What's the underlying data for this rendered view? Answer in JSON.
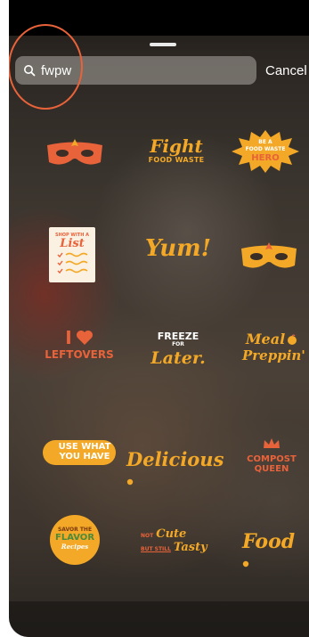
{
  "search": {
    "query": "fwpw",
    "cancel_label": "Cancel"
  },
  "colors": {
    "accent_orange": "#f3a927",
    "accent_red": "#e8623a"
  },
  "stickers": {
    "fight": {
      "line1": "Fight",
      "line2": "FOOD WASTE"
    },
    "hero": {
      "line1": "BE A",
      "line2": "FOOD WASTE",
      "line3": "HERO"
    },
    "list": {
      "line1": "SHOP WITH A",
      "line2": "List"
    },
    "yum": {
      "text": "Yum!"
    },
    "leftovers": {
      "line1": "I",
      "line2": "LEFTOVERS"
    },
    "freeze": {
      "line1": "FREEZE",
      "line2": "FOR",
      "line3": "Later."
    },
    "meal": {
      "line1": "Meal",
      "line2": "Preppin'"
    },
    "use": {
      "line1": "USE WHAT",
      "line2": "YOU HAVE"
    },
    "delicious": {
      "text": "Delicious"
    },
    "compost": {
      "line1": "COMPOST",
      "line2": "QUEEN"
    },
    "savor": {
      "line1": "SAVOR THE",
      "line2": "FLAVOR",
      "line3": "Recipes"
    },
    "notcute": {
      "line1": "NOT",
      "line2": "Cute",
      "line3": "BUT STILL",
      "line4": "Tasty"
    },
    "food": {
      "text": "Food"
    }
  }
}
